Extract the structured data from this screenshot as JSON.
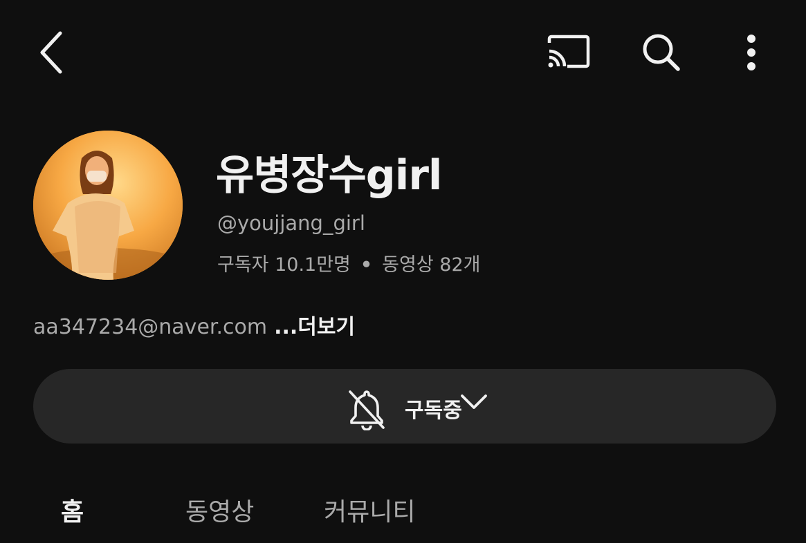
{
  "header": {
    "back_icon": "back-arrow-icon",
    "cast_icon": "cast-icon",
    "search_icon": "search-icon",
    "more_icon": "more-vertical-icon"
  },
  "channel": {
    "name": "유병장수girl",
    "handle": "@youjjang_girl",
    "subscribers": "구독자 10.1만명",
    "separator": "•",
    "videos": "동영상 82개",
    "description": "aa347234@naver.com",
    "more_label": "...더보기"
  },
  "subscribe": {
    "label": "구독중",
    "bell_icon": "bell-off-icon",
    "dropdown_icon": "chevron-down-icon"
  },
  "tabs": [
    {
      "label": "홈",
      "active": true
    },
    {
      "label": "동영상",
      "active": false
    },
    {
      "label": "커뮤니티",
      "active": false
    }
  ],
  "colors": {
    "background": "#0f0f0f",
    "primary_text": "#f1f1f1",
    "secondary_text": "#aaaaaa",
    "button_bg": "#272727"
  }
}
